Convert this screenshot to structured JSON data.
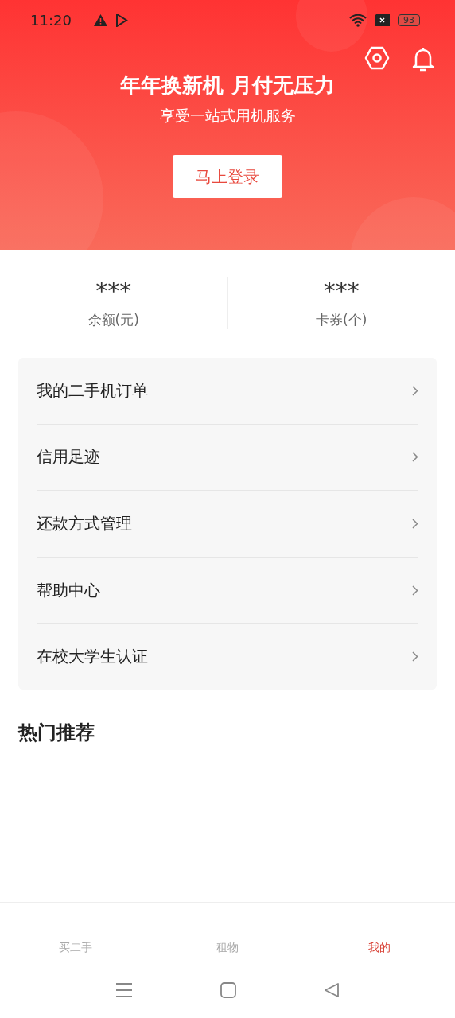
{
  "status_bar": {
    "time": "11:20",
    "battery": "93"
  },
  "header": {
    "title": "年年换新机 月付无压力",
    "subtitle": "享受一站式用机服务",
    "login_button": "马上登录"
  },
  "stats": [
    {
      "value": "***",
      "label": "余额(元)"
    },
    {
      "value": "***",
      "label": "卡券(个)"
    }
  ],
  "menu": [
    "我的二手机订单",
    "信用足迹",
    "还款方式管理",
    "帮助中心",
    "在校大学生认证"
  ],
  "section_title": "热门推荐",
  "tabs": [
    {
      "label": "买二手",
      "selected": false
    },
    {
      "label": "租物",
      "selected": false
    },
    {
      "label": "我的",
      "selected": true
    }
  ]
}
